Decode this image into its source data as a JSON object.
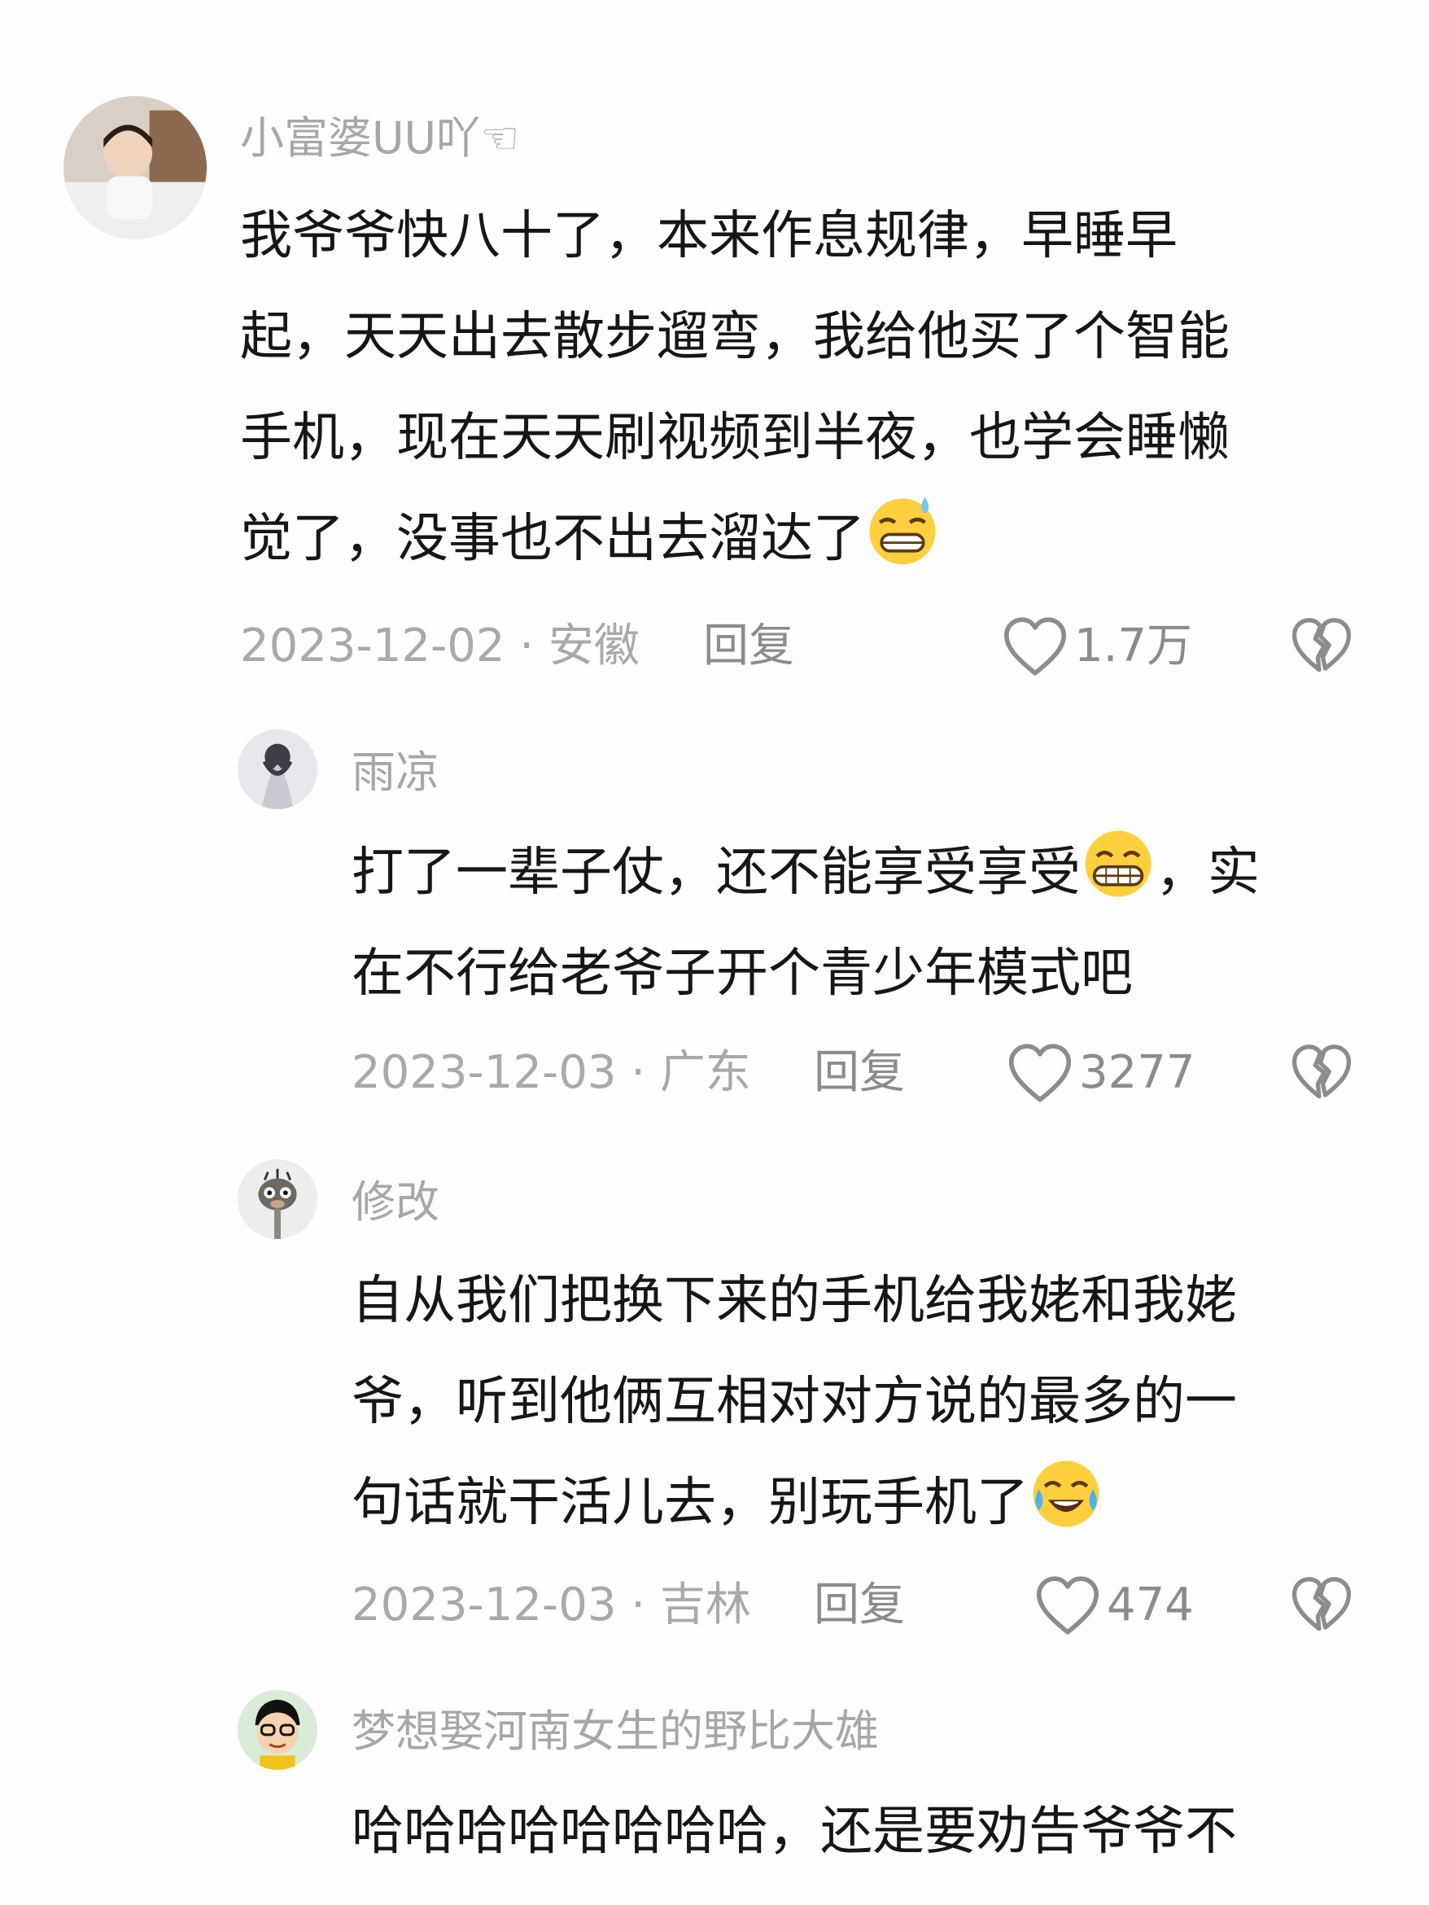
{
  "comments": [
    {
      "username": "小富婆UU吖☜",
      "lines": [
        "我爷爷快八十了，本来作息规律，早睡早",
        "起，天天出去散步遛弯，我给他买了个智能",
        "手机，现在天天刷视频到半夜，也学会睡懒",
        "觉了，没事也不出去溜达了"
      ],
      "emoji": "sweat-grin-emoji",
      "meta": "2023-12-02 · 安徽",
      "reply": "回复",
      "likes": "1.7万"
    },
    {
      "username": "雨凉",
      "lines": [
        "打了一辈子仗，还不能享受享受",
        "，实",
        "在不行给老爷子开个青少年模式吧"
      ],
      "emoji": "grin-emoji",
      "meta": "2023-12-03 · 广东",
      "reply": "回复",
      "likes": "3277"
    },
    {
      "username": "修改",
      "lines": [
        "自从我们把换下来的手机给我姥和我姥",
        "爷，听到他俩互相对对方说的最多的一",
        "句话就干活儿去，别玩手机了"
      ],
      "emoji": "laugh-cry-emoji",
      "meta": "2023-12-03 · 吉林",
      "reply": "回复",
      "likes": "474"
    },
    {
      "username": "梦想娶河南女生的野比大雄",
      "lines": [
        "哈哈哈哈哈哈哈哈，还是要劝告爷爷不"
      ]
    }
  ],
  "icons": {
    "like": "heart-outline-icon",
    "dislike": "broken-heart-icon"
  },
  "colors": {
    "text": "#161616",
    "muted": "#a7a7a7",
    "action": "#8c8c8c"
  }
}
